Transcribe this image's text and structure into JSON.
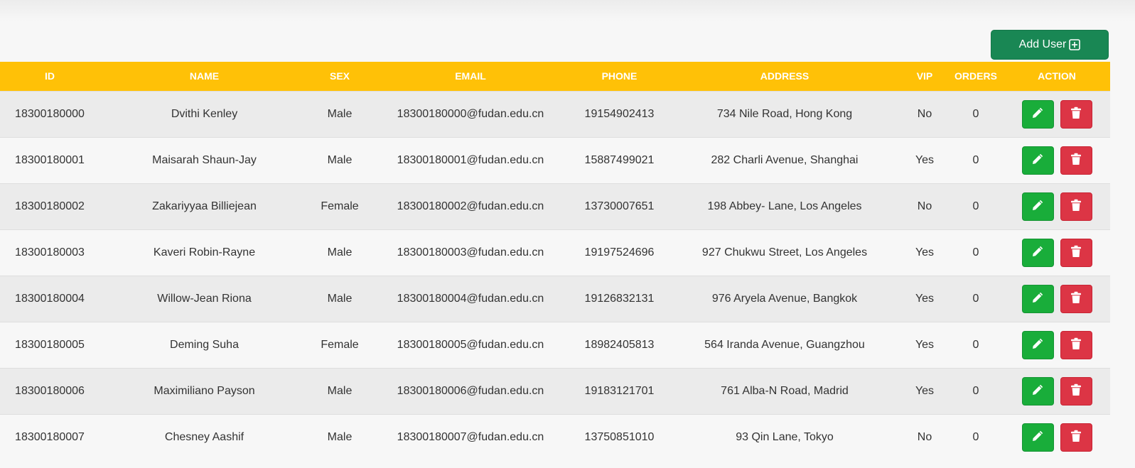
{
  "toolbar": {
    "add_user_label": "Add User",
    "add_user_icon": "plus-box-icon",
    "add_user_color": "#198754"
  },
  "table": {
    "header_color": "#ffc107",
    "columns": [
      "ID",
      "NAME",
      "SEX",
      "EMAIL",
      "PHONE",
      "ADDRESS",
      "VIP",
      "ORDERS",
      "ACTION"
    ],
    "rows": [
      {
        "id": "18300180000",
        "name": "Dvithi Kenley",
        "sex": "Male",
        "email": "18300180000@fudan.edu.cn",
        "phone": "19154902413",
        "address": "734 Nile Road, Hong Kong",
        "vip": "No",
        "orders": "0"
      },
      {
        "id": "18300180001",
        "name": "Maisarah Shaun-Jay",
        "sex": "Male",
        "email": "18300180001@fudan.edu.cn",
        "phone": "15887499021",
        "address": "282 Charli Avenue, Shanghai",
        "vip": "Yes",
        "orders": "0"
      },
      {
        "id": "18300180002",
        "name": "Zakariyyaa Billiejean",
        "sex": "Female",
        "email": "18300180002@fudan.edu.cn",
        "phone": "13730007651",
        "address": "198 Abbey- Lane, Los Angeles",
        "vip": "No",
        "orders": "0"
      },
      {
        "id": "18300180003",
        "name": "Kaveri Robin-Rayne",
        "sex": "Male",
        "email": "18300180003@fudan.edu.cn",
        "phone": "19197524696",
        "address": "927 Chukwu Street, Los Angeles",
        "vip": "Yes",
        "orders": "0"
      },
      {
        "id": "18300180004",
        "name": "Willow-Jean Riona",
        "sex": "Male",
        "email": "18300180004@fudan.edu.cn",
        "phone": "19126832131",
        "address": "976 Aryela Avenue, Bangkok",
        "vip": "Yes",
        "orders": "0"
      },
      {
        "id": "18300180005",
        "name": "Deming Suha",
        "sex": "Female",
        "email": "18300180005@fudan.edu.cn",
        "phone": "18982405813",
        "address": "564 Iranda Avenue, Guangzhou",
        "vip": "Yes",
        "orders": "0"
      },
      {
        "id": "18300180006",
        "name": "Maximiliano Payson",
        "sex": "Male",
        "email": "18300180006@fudan.edu.cn",
        "phone": "19183121701",
        "address": "761 Alba-N Road, Madrid",
        "vip": "Yes",
        "orders": "0"
      },
      {
        "id": "18300180007",
        "name": "Chesney Aashif",
        "sex": "Male",
        "email": "18300180007@fudan.edu.cn",
        "phone": "13750851010",
        "address": "93 Qin Lane, Tokyo",
        "vip": "No",
        "orders": "0"
      }
    ],
    "row_actions": {
      "edit_icon": "pencil-icon",
      "edit_color": "#19ad3a",
      "delete_icon": "trash-icon",
      "delete_color": "#dc3545"
    }
  }
}
